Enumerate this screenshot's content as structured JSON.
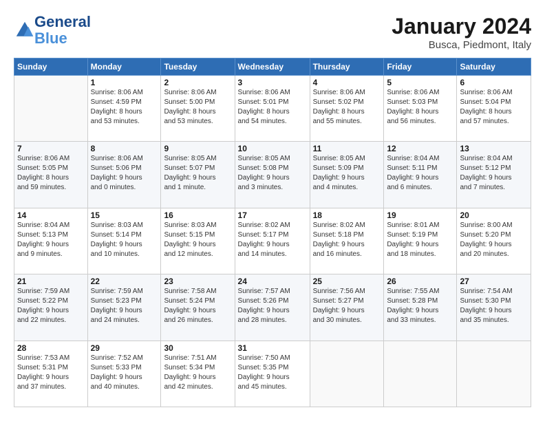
{
  "logo": {
    "line1": "General",
    "line2": "Blue"
  },
  "title": "January 2024",
  "subtitle": "Busca, Piedmont, Italy",
  "columns": [
    "Sunday",
    "Monday",
    "Tuesday",
    "Wednesday",
    "Thursday",
    "Friday",
    "Saturday"
  ],
  "weeks": [
    [
      {
        "day": "",
        "info": ""
      },
      {
        "day": "1",
        "info": "Sunrise: 8:06 AM\nSunset: 4:59 PM\nDaylight: 8 hours\nand 53 minutes."
      },
      {
        "day": "2",
        "info": "Sunrise: 8:06 AM\nSunset: 5:00 PM\nDaylight: 8 hours\nand 53 minutes."
      },
      {
        "day": "3",
        "info": "Sunrise: 8:06 AM\nSunset: 5:01 PM\nDaylight: 8 hours\nand 54 minutes."
      },
      {
        "day": "4",
        "info": "Sunrise: 8:06 AM\nSunset: 5:02 PM\nDaylight: 8 hours\nand 55 minutes."
      },
      {
        "day": "5",
        "info": "Sunrise: 8:06 AM\nSunset: 5:03 PM\nDaylight: 8 hours\nand 56 minutes."
      },
      {
        "day": "6",
        "info": "Sunrise: 8:06 AM\nSunset: 5:04 PM\nDaylight: 8 hours\nand 57 minutes."
      }
    ],
    [
      {
        "day": "7",
        "info": "Sunrise: 8:06 AM\nSunset: 5:05 PM\nDaylight: 8 hours\nand 59 minutes."
      },
      {
        "day": "8",
        "info": "Sunrise: 8:06 AM\nSunset: 5:06 PM\nDaylight: 9 hours\nand 0 minutes."
      },
      {
        "day": "9",
        "info": "Sunrise: 8:05 AM\nSunset: 5:07 PM\nDaylight: 9 hours\nand 1 minute."
      },
      {
        "day": "10",
        "info": "Sunrise: 8:05 AM\nSunset: 5:08 PM\nDaylight: 9 hours\nand 3 minutes."
      },
      {
        "day": "11",
        "info": "Sunrise: 8:05 AM\nSunset: 5:09 PM\nDaylight: 9 hours\nand 4 minutes."
      },
      {
        "day": "12",
        "info": "Sunrise: 8:04 AM\nSunset: 5:11 PM\nDaylight: 9 hours\nand 6 minutes."
      },
      {
        "day": "13",
        "info": "Sunrise: 8:04 AM\nSunset: 5:12 PM\nDaylight: 9 hours\nand 7 minutes."
      }
    ],
    [
      {
        "day": "14",
        "info": "Sunrise: 8:04 AM\nSunset: 5:13 PM\nDaylight: 9 hours\nand 9 minutes."
      },
      {
        "day": "15",
        "info": "Sunrise: 8:03 AM\nSunset: 5:14 PM\nDaylight: 9 hours\nand 10 minutes."
      },
      {
        "day": "16",
        "info": "Sunrise: 8:03 AM\nSunset: 5:15 PM\nDaylight: 9 hours\nand 12 minutes."
      },
      {
        "day": "17",
        "info": "Sunrise: 8:02 AM\nSunset: 5:17 PM\nDaylight: 9 hours\nand 14 minutes."
      },
      {
        "day": "18",
        "info": "Sunrise: 8:02 AM\nSunset: 5:18 PM\nDaylight: 9 hours\nand 16 minutes."
      },
      {
        "day": "19",
        "info": "Sunrise: 8:01 AM\nSunset: 5:19 PM\nDaylight: 9 hours\nand 18 minutes."
      },
      {
        "day": "20",
        "info": "Sunrise: 8:00 AM\nSunset: 5:20 PM\nDaylight: 9 hours\nand 20 minutes."
      }
    ],
    [
      {
        "day": "21",
        "info": "Sunrise: 7:59 AM\nSunset: 5:22 PM\nDaylight: 9 hours\nand 22 minutes."
      },
      {
        "day": "22",
        "info": "Sunrise: 7:59 AM\nSunset: 5:23 PM\nDaylight: 9 hours\nand 24 minutes."
      },
      {
        "day": "23",
        "info": "Sunrise: 7:58 AM\nSunset: 5:24 PM\nDaylight: 9 hours\nand 26 minutes."
      },
      {
        "day": "24",
        "info": "Sunrise: 7:57 AM\nSunset: 5:26 PM\nDaylight: 9 hours\nand 28 minutes."
      },
      {
        "day": "25",
        "info": "Sunrise: 7:56 AM\nSunset: 5:27 PM\nDaylight: 9 hours\nand 30 minutes."
      },
      {
        "day": "26",
        "info": "Sunrise: 7:55 AM\nSunset: 5:28 PM\nDaylight: 9 hours\nand 33 minutes."
      },
      {
        "day": "27",
        "info": "Sunrise: 7:54 AM\nSunset: 5:30 PM\nDaylight: 9 hours\nand 35 minutes."
      }
    ],
    [
      {
        "day": "28",
        "info": "Sunrise: 7:53 AM\nSunset: 5:31 PM\nDaylight: 9 hours\nand 37 minutes."
      },
      {
        "day": "29",
        "info": "Sunrise: 7:52 AM\nSunset: 5:33 PM\nDaylight: 9 hours\nand 40 minutes."
      },
      {
        "day": "30",
        "info": "Sunrise: 7:51 AM\nSunset: 5:34 PM\nDaylight: 9 hours\nand 42 minutes."
      },
      {
        "day": "31",
        "info": "Sunrise: 7:50 AM\nSunset: 5:35 PM\nDaylight: 9 hours\nand 45 minutes."
      },
      {
        "day": "",
        "info": ""
      },
      {
        "day": "",
        "info": ""
      },
      {
        "day": "",
        "info": ""
      }
    ]
  ]
}
